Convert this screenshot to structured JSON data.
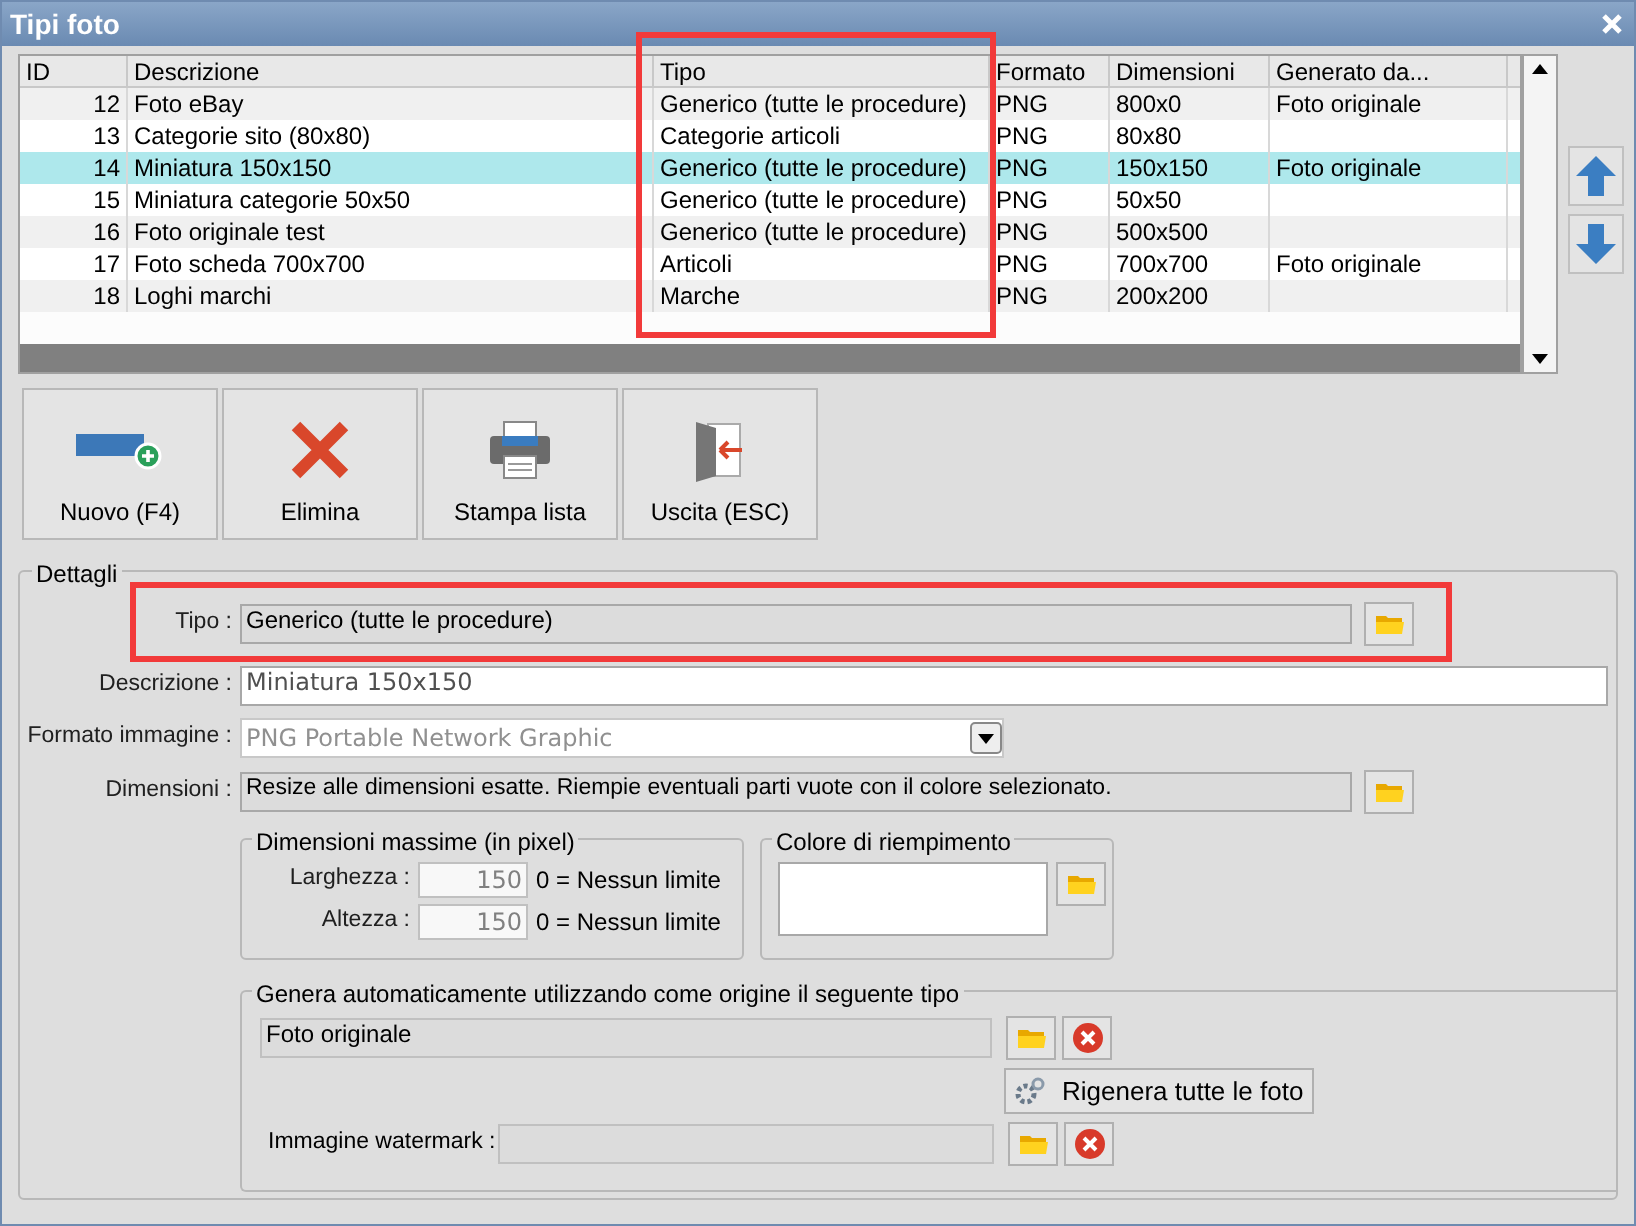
{
  "window": {
    "title": "Tipi foto"
  },
  "table": {
    "columns": [
      "ID",
      "Descrizione",
      "Tipo",
      "Formato",
      "Dimensioni",
      "Generato da..."
    ],
    "rows": [
      {
        "cells": [
          "12",
          "Foto eBay",
          "Generico (tutte le procedure)",
          "PNG",
          "800x0",
          "Foto originale"
        ],
        "selected": false
      },
      {
        "cells": [
          "13",
          "Categorie sito (80x80)",
          "Categorie articoli",
          "PNG",
          "80x80",
          ""
        ],
        "selected": false
      },
      {
        "cells": [
          "14",
          "Miniatura 150x150",
          "Generico (tutte le procedure)",
          "PNG",
          "150x150",
          "Foto originale"
        ],
        "selected": true
      },
      {
        "cells": [
          "15",
          "Miniatura categorie 50x50",
          "Generico (tutte le procedure)",
          "PNG",
          "50x50",
          ""
        ],
        "selected": false
      },
      {
        "cells": [
          "16",
          "Foto originale test",
          "Generico (tutte le procedure)",
          "PNG",
          "500x500",
          ""
        ],
        "selected": false
      },
      {
        "cells": [
          "17",
          "Foto scheda 700x700",
          "Articoli",
          "PNG",
          "700x700",
          "Foto originale"
        ],
        "selected": false
      },
      {
        "cells": [
          "18",
          "Loghi marchi",
          "Marche",
          "PNG",
          "200x200",
          ""
        ],
        "selected": false
      }
    ]
  },
  "toolbar": [
    {
      "kind": "new",
      "label": "Nuovo (F4)"
    },
    {
      "kind": "delete",
      "label": "Elimina"
    },
    {
      "kind": "print",
      "label": "Stampa lista"
    },
    {
      "kind": "exit",
      "label": "Uscita (ESC)"
    }
  ],
  "details": {
    "legend": "Dettagli",
    "tipo": {
      "label": "Tipo :",
      "value": "Generico (tutte le procedure)"
    },
    "descrizione": {
      "label": "Descrizione :",
      "value": "Miniatura 150x150"
    },
    "formato": {
      "label": "Formato immagine :",
      "value": "PNG Portable Network Graphic"
    },
    "dimensioni": {
      "label": "Dimensioni :",
      "value": "Resize alle dimensioni esatte. Riempie eventuali parti vuote con il colore selezionato."
    },
    "max": {
      "legend": "Dimensioni massime (in pixel)",
      "rows": [
        {
          "label": "Larghezza :",
          "value": "150",
          "hint": "0 = Nessun limite"
        },
        {
          "label": "Altezza :",
          "value": "150",
          "hint": "0 = Nessun limite"
        }
      ]
    },
    "fill": {
      "legend": "Colore di riempimento"
    },
    "generate": {
      "legend": "Genera automaticamente utilizzando come origine il seguente tipo",
      "source": "Foto originale",
      "regen": "Rigenera tutte le foto",
      "watermark_label": "Immagine watermark :"
    }
  }
}
